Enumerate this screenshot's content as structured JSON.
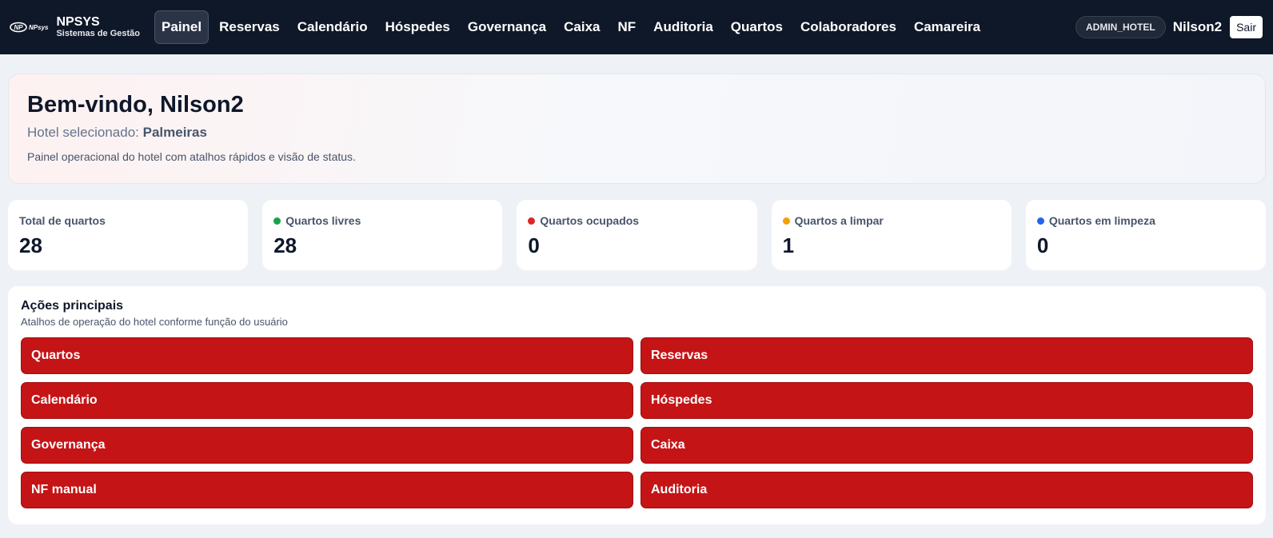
{
  "brand": {
    "logo_text": "NPsys",
    "title": "NPSYS",
    "subtitle": "Sistemas de Gestão"
  },
  "nav": {
    "items": [
      {
        "label": "Painel",
        "active": true
      },
      {
        "label": "Reservas"
      },
      {
        "label": "Calendário"
      },
      {
        "label": "Hóspedes"
      },
      {
        "label": "Governança"
      },
      {
        "label": "Caixa"
      },
      {
        "label": "NF"
      },
      {
        "label": "Auditoria"
      },
      {
        "label": "Quartos"
      },
      {
        "label": "Colaboradores"
      },
      {
        "label": "Camareira"
      }
    ]
  },
  "user": {
    "role": "ADMIN_HOTEL",
    "name": "Nilson2",
    "logout_label": "Sair"
  },
  "welcome": {
    "title": "Bem-vindo, Nilson2",
    "hotel_prefix": "Hotel selecionado:",
    "hotel_name": "Palmeiras",
    "description": "Painel operacional do hotel com atalhos rápidos e visão de status."
  },
  "stats": [
    {
      "label": "Total de quartos",
      "value": "28",
      "dot_color": ""
    },
    {
      "label": "Quartos livres",
      "value": "28",
      "dot_color": "#16a34a"
    },
    {
      "label": "Quartos ocupados",
      "value": "0",
      "dot_color": "#dc2626"
    },
    {
      "label": "Quartos a limpar",
      "value": "1",
      "dot_color": "#f59e0b"
    },
    {
      "label": "Quartos em limpeza",
      "value": "0",
      "dot_color": "#2563eb"
    }
  ],
  "actions": {
    "title": "Ações principais",
    "subtitle": "Atalhos de operação do hotel conforme função do usuário",
    "buttons": [
      "Quartos",
      "Reservas",
      "Calendário",
      "Hóspedes",
      "Governança",
      "Caixa",
      "NF manual",
      "Auditoria"
    ]
  },
  "colors": {
    "topbar": "#0f1828",
    "accent_red": "#c51416"
  }
}
